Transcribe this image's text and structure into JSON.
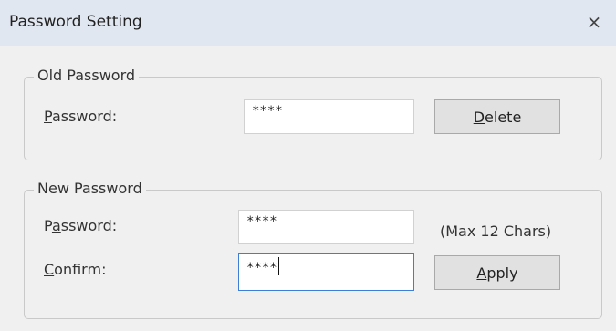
{
  "window": {
    "title": "Password Setting",
    "close_glyph": "×",
    "close_icon": "close-icon"
  },
  "old_password": {
    "legend": "Old Password",
    "password_label_mnemonic": "P",
    "password_label_rest": "assword:",
    "password_value": "****",
    "delete_label_mnemonic": "D",
    "delete_label_rest": "elete"
  },
  "new_password": {
    "legend": "New Password",
    "password_label_pre": "P",
    "password_label_mnemonic": "a",
    "password_label_rest": "ssword:",
    "password_value": "****",
    "max_hint": "(Max 12 Chars)",
    "confirm_label_mnemonic": "C",
    "confirm_label_rest": "onfirm:",
    "confirm_value": "****",
    "apply_label_mnemonic": "A",
    "apply_label_rest": "pply"
  }
}
